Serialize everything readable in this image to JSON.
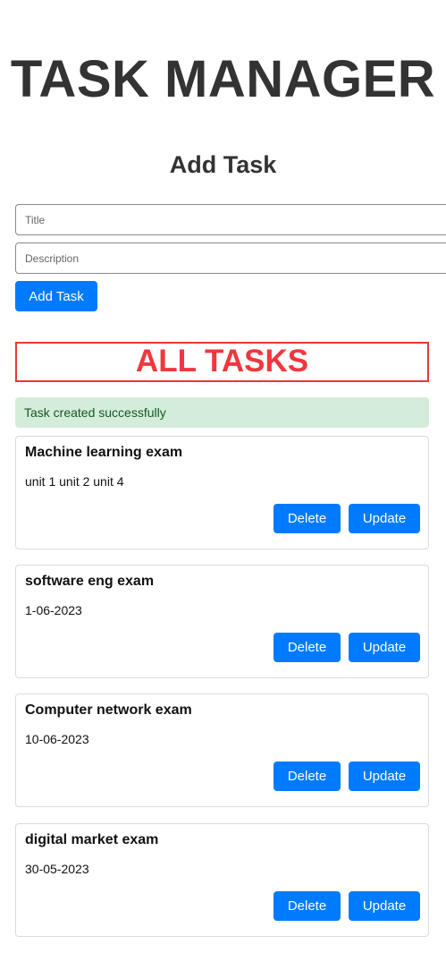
{
  "app": {
    "title": "TASK MANAGER"
  },
  "add_form": {
    "heading": "Add Task",
    "title_placeholder": "Title",
    "description_placeholder": "Description",
    "submit_label": "Add Task"
  },
  "task_list": {
    "heading": "ALL TASKS",
    "alert": "Task created successfully",
    "delete_label": "Delete",
    "update_label": "Update",
    "tasks": [
      {
        "title": "Machine learning exam",
        "description": "unit 1 unit 2 unit 4"
      },
      {
        "title": "software eng exam",
        "description": "1-06-2023"
      },
      {
        "title": "Computer network exam",
        "description": "10-06-2023"
      },
      {
        "title": "digital market exam",
        "description": "30-05-2023"
      }
    ]
  },
  "colors": {
    "primary": "#007bff",
    "heading_red": "#f0373f",
    "success_bg": "#d4edda",
    "success_text": "#155724"
  }
}
